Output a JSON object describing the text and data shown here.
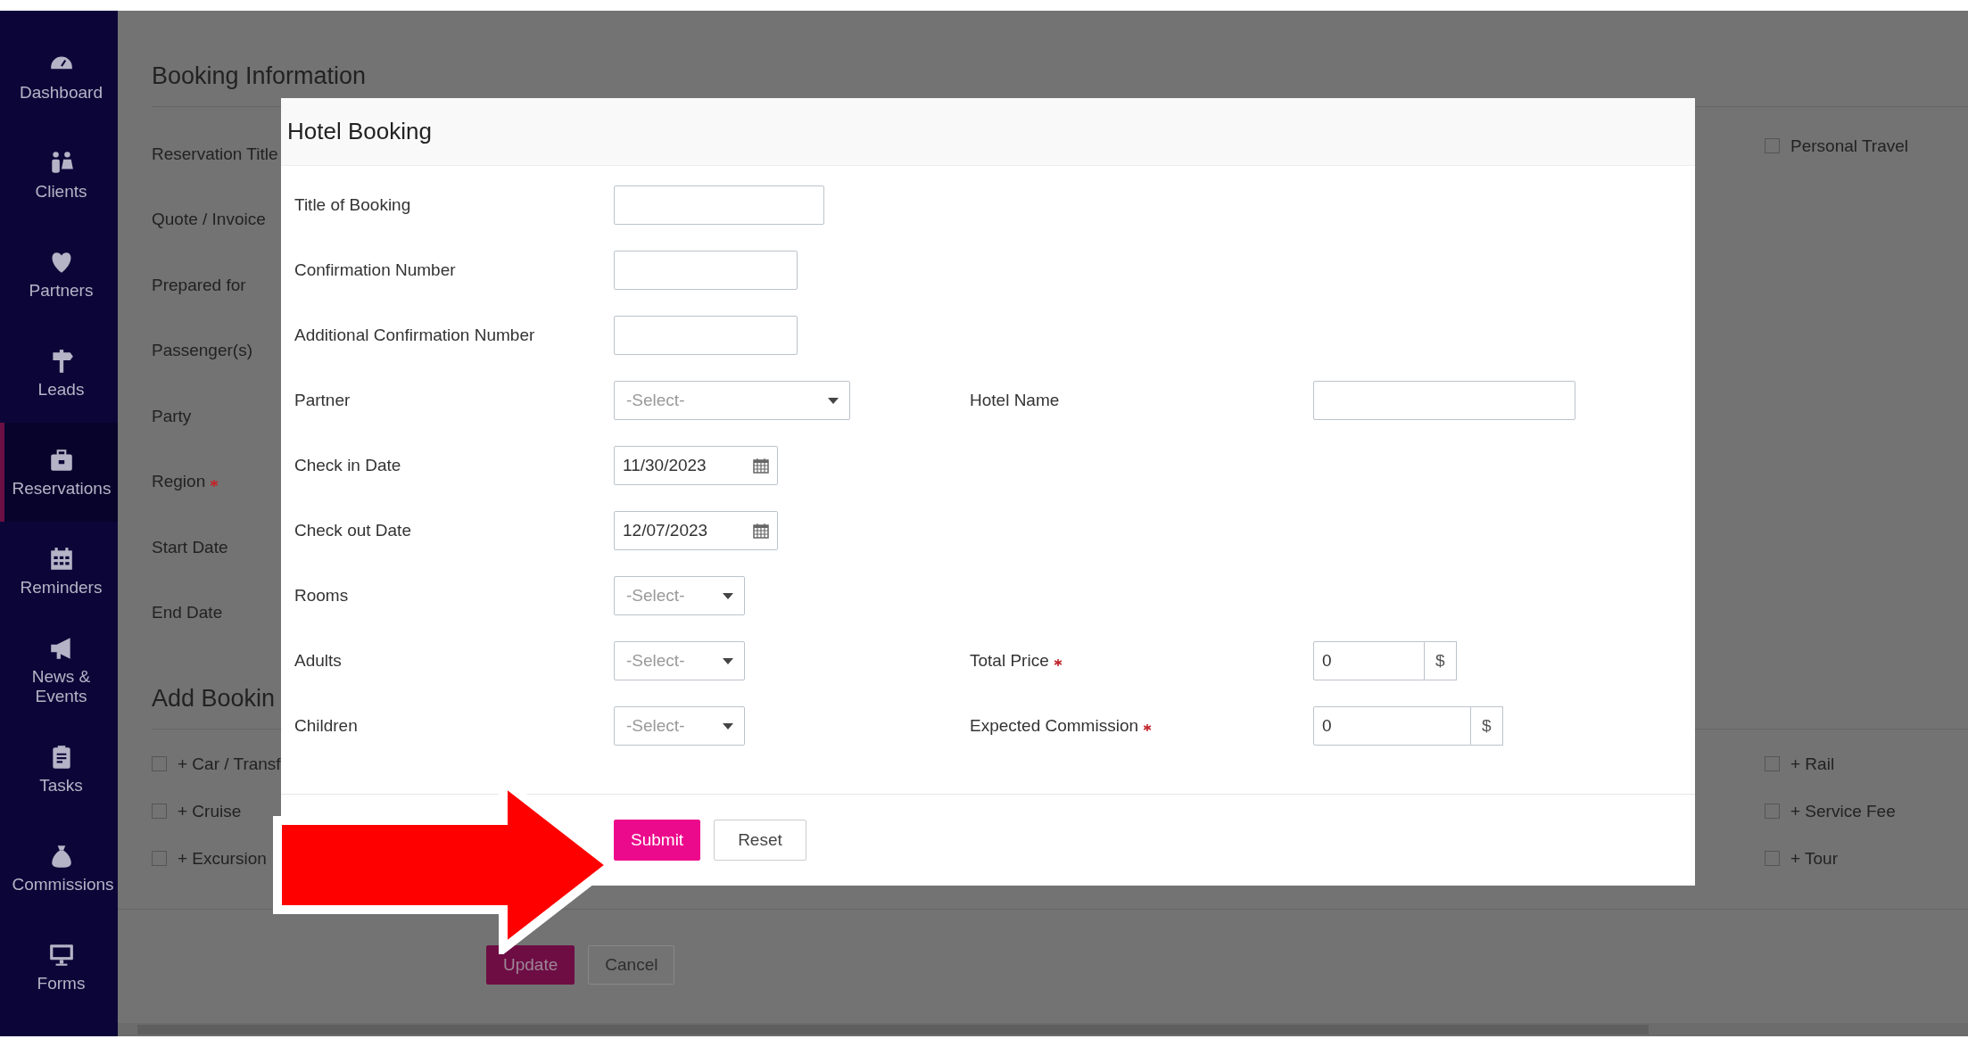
{
  "sidebar": {
    "items": [
      {
        "label": "Dashboard",
        "selected": false
      },
      {
        "label": "Clients",
        "selected": false
      },
      {
        "label": "Partners",
        "selected": false
      },
      {
        "label": "Leads",
        "selected": false
      },
      {
        "label": "Reservations",
        "selected": true
      },
      {
        "label": "Reminders",
        "selected": false
      },
      {
        "label": "News & Events",
        "selected": false
      },
      {
        "label": "Tasks",
        "selected": false
      },
      {
        "label": "Commissions",
        "selected": false
      },
      {
        "label": "Forms",
        "selected": false
      }
    ]
  },
  "booking_information": {
    "title": "Booking Information",
    "fields": [
      {
        "label": "Reservation Title",
        "required": false
      },
      {
        "label": "Quote / Invoice",
        "required": false
      },
      {
        "label": "Prepared for",
        "required": false
      },
      {
        "label": "Passenger(s)",
        "required": false
      },
      {
        "label": "Party",
        "required": false
      },
      {
        "label": "Region",
        "required": true
      },
      {
        "label": "Start Date",
        "required": false
      },
      {
        "label": "End Date",
        "required": false
      }
    ],
    "personal_travel": {
      "label": "Personal Travel",
      "checked": false
    }
  },
  "add_booking": {
    "title": "Add Bookin",
    "left_options": [
      {
        "label": "+ Car / Transf",
        "checked": false
      },
      {
        "label": "+ Cruise",
        "checked": false
      },
      {
        "label": "+ Excursion",
        "checked": false
      }
    ],
    "right_options": [
      {
        "label": "+ Rail",
        "checked": false
      },
      {
        "label": "+ Service Fee",
        "checked": false
      },
      {
        "label": "+ Tour",
        "checked": false
      }
    ]
  },
  "page_buttons": [
    {
      "label": "Update",
      "kind": "primary"
    },
    {
      "label": "Cancel",
      "kind": "secondary"
    }
  ],
  "modal": {
    "title": "Hotel Booking",
    "rows": [
      {
        "left": {
          "label": "Title of Booking",
          "kind": "text",
          "required": false
        }
      },
      {
        "left": {
          "label": "Confirmation Number",
          "kind": "text",
          "required": false
        }
      },
      {
        "left": {
          "label": "Additional Confirmation Number",
          "kind": "text",
          "required": false
        }
      },
      {
        "left": {
          "label": "Partner",
          "kind": "select",
          "placeholder": "-Select-",
          "required": false
        },
        "right": {
          "label": "Hotel Name",
          "kind": "text",
          "required": false
        }
      },
      {
        "left": {
          "label": "Check in Date",
          "kind": "date",
          "value": "11/30/2023",
          "required": false
        }
      },
      {
        "left": {
          "label": "Check out Date",
          "kind": "date",
          "value": "12/07/2023",
          "required": false
        }
      },
      {
        "left": {
          "label": "Rooms",
          "kind": "select",
          "placeholder": "-Select-",
          "required": false
        }
      },
      {
        "left": {
          "label": "Adults",
          "kind": "select",
          "placeholder": "-Select-",
          "required": false
        },
        "right": {
          "label": "Total Price",
          "kind": "price",
          "value": "0",
          "addon": "$",
          "required": true
        }
      },
      {
        "left": {
          "label": "Children",
          "kind": "select",
          "placeholder": "-Select-",
          "required": false
        },
        "right": {
          "label": "Expected Commission",
          "kind": "price",
          "value": "0",
          "addon": "$",
          "required": true
        }
      }
    ],
    "buttons": [
      {
        "label": "Submit",
        "kind": "primary"
      },
      {
        "label": "Reset",
        "kind": "secondary"
      }
    ]
  }
}
